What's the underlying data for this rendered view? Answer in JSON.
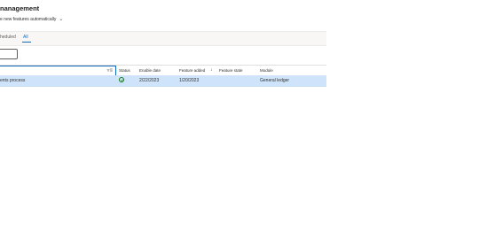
{
  "page": {
    "title": "nanagement",
    "enable_new_features": "e new features automatically"
  },
  "tabs": [
    {
      "label": "heduled"
    },
    {
      "label": "All"
    }
  ],
  "grid": {
    "columns": {
      "status": "Status",
      "enable_date": "Enable date",
      "feature_added": "Feature added",
      "feature_state": "Feature state",
      "module": "Module"
    },
    "rows": [
      {
        "name": "ents process",
        "status_icon": "checkmark-circle-icon",
        "enable_date": "2/22/2023",
        "feature_added": "1/20/2023",
        "feature_state": "",
        "module": "General ledger"
      }
    ]
  },
  "colors": {
    "accent": "#0f6cbd",
    "selected_row": "#cfe4fa",
    "success": "#107c10"
  }
}
